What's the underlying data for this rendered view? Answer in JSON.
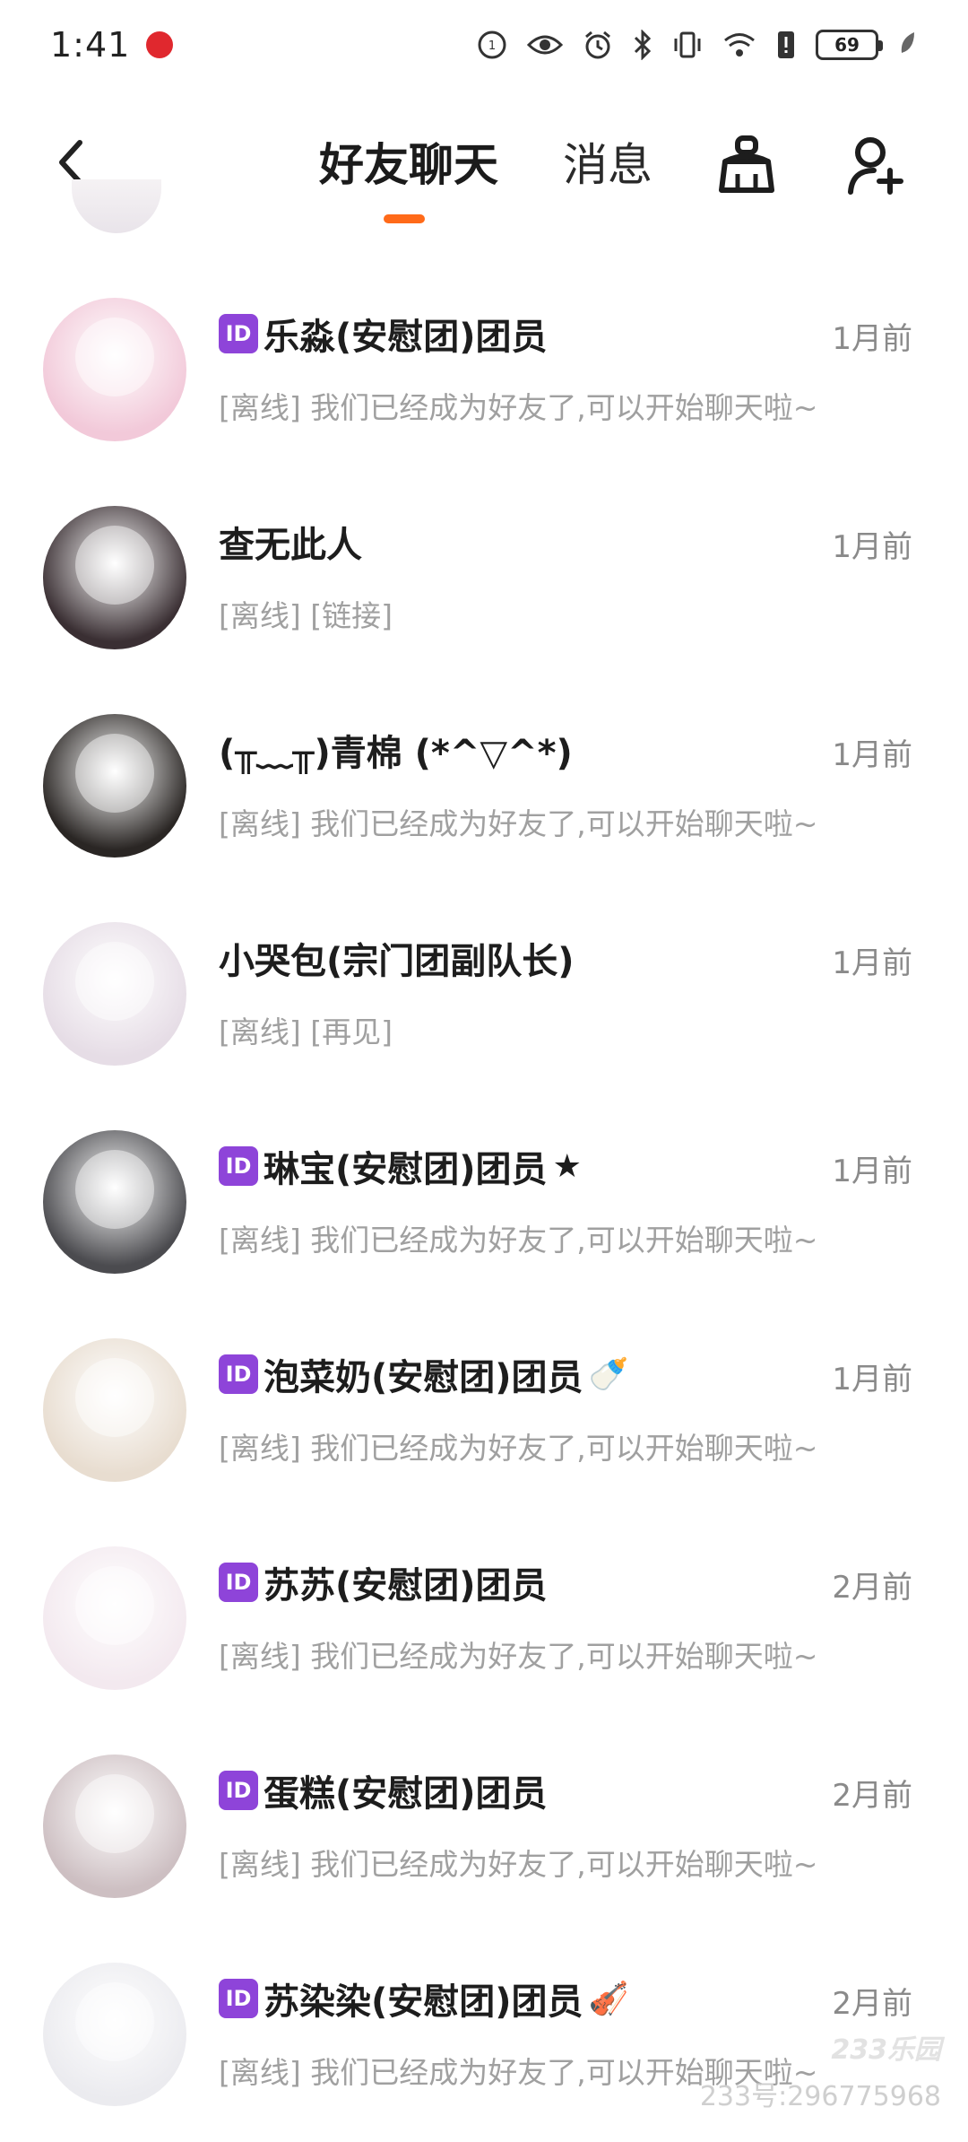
{
  "status_bar": {
    "time": "1:41",
    "battery": "69",
    "icons": [
      "rec-icon",
      "eye-icon",
      "alarm-icon",
      "bluetooth-icon",
      "vibrate-icon",
      "wifi-icon",
      "alert-icon",
      "battery-icon",
      "leaf-icon"
    ]
  },
  "nav": {
    "back_icon": "chevron-left-icon",
    "tabs": [
      {
        "label": "好友聊天",
        "active": true
      },
      {
        "label": "消息",
        "active": false
      }
    ],
    "clean_icon": "broom-icon",
    "add_friend_icon": "add-user-icon",
    "accent_color": "#ff6a19"
  },
  "chats": [
    {
      "badge": "ID",
      "name": "乐淼(安慰团)团员",
      "suffix": "",
      "time": "1月前",
      "preview": "[离线] 我们已经成为好友了,可以开始聊天啦~",
      "avatar_color": "#f2c9d9"
    },
    {
      "badge": "",
      "name": "查无此人",
      "suffix": "",
      "time": "1月前",
      "preview": "[离线] [链接]",
      "avatar_color": "#3a2f33"
    },
    {
      "badge": "",
      "name": "(╥﹏╥)青棉 (*^▽^*)",
      "suffix": "",
      "time": "1月前",
      "preview": "[离线] 我们已经成为好友了,可以开始聊天啦~",
      "avatar_color": "#2a2624"
    },
    {
      "badge": "",
      "name": "小哭包(宗门团副队长)",
      "suffix": "",
      "time": "1月前",
      "preview": "[离线] [再见]",
      "avatar_color": "#e6dde6"
    },
    {
      "badge": "ID",
      "name": "琳宝(安慰团)团员",
      "suffix": "★",
      "time": "1月前",
      "preview": "[离线] 我们已经成为好友了,可以开始聊天啦~",
      "avatar_color": "#4b4b4f"
    },
    {
      "badge": "ID",
      "name": "泡菜奶(安慰团)团员",
      "suffix": "🍼",
      "time": "1月前",
      "preview": "[离线] 我们已经成为好友了,可以开始聊天啦~",
      "avatar_color": "#e8ddd0"
    },
    {
      "badge": "ID",
      "name": "苏苏(安慰团)团员",
      "suffix": "",
      "time": "2月前",
      "preview": "[离线] 我们已经成为好友了,可以开始聊天啦~",
      "avatar_color": "#f3e9ef"
    },
    {
      "badge": "ID",
      "name": "蛋糕(安慰团)团员",
      "suffix": "",
      "time": "2月前",
      "preview": "[离线] 我们已经成为好友了,可以开始聊天啦~",
      "avatar_color": "#cdbfc2"
    },
    {
      "badge": "ID",
      "name": "苏染染(安慰团)团员",
      "suffix": "🎻",
      "time": "2月前",
      "preview": "[离线] 我们已经成为好友了,可以开始聊天啦~",
      "avatar_color": "#ebebef"
    }
  ],
  "watermark": {
    "logo": "233乐园",
    "id_text": "233号:296775968"
  }
}
